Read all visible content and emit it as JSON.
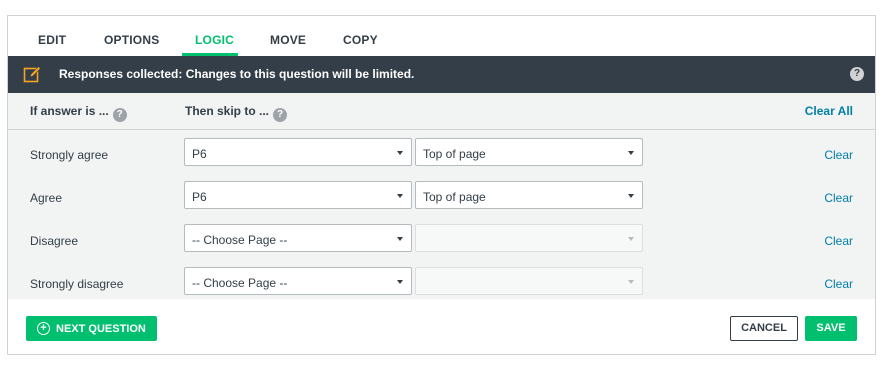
{
  "tabs": [
    {
      "label": "EDIT"
    },
    {
      "label": "OPTIONS"
    },
    {
      "label": "LOGIC",
      "active": true
    },
    {
      "label": "MOVE"
    },
    {
      "label": "COPY"
    }
  ],
  "notice": {
    "icon": "edit-icon",
    "text": "Responses collected: Changes to this question will be limited.",
    "help": "?"
  },
  "logic": {
    "if_header": "If answer is ...",
    "then_header": "Then skip to ...",
    "help": "?",
    "clear_all": "Clear All",
    "rows": [
      {
        "answer": "Strongly agree",
        "page": "P6",
        "position": "Top of page",
        "position_enabled": true,
        "clear": "Clear"
      },
      {
        "answer": "Agree",
        "page": "P6",
        "position": "Top of page",
        "position_enabled": true,
        "clear": "Clear"
      },
      {
        "answer": "Disagree",
        "page": "-- Choose Page --",
        "position": "",
        "position_enabled": false,
        "clear": "Clear"
      },
      {
        "answer": "Strongly disagree",
        "page": "-- Choose Page --",
        "position": "",
        "position_enabled": false,
        "clear": "Clear"
      }
    ]
  },
  "footer": {
    "next_question": "NEXT QUESTION",
    "next_icon": "plus-circle-icon",
    "cancel": "CANCEL",
    "save": "SAVE"
  },
  "colors": {
    "accent": "#00bf6f",
    "notice_bg": "#333e48",
    "link": "#007faa"
  }
}
